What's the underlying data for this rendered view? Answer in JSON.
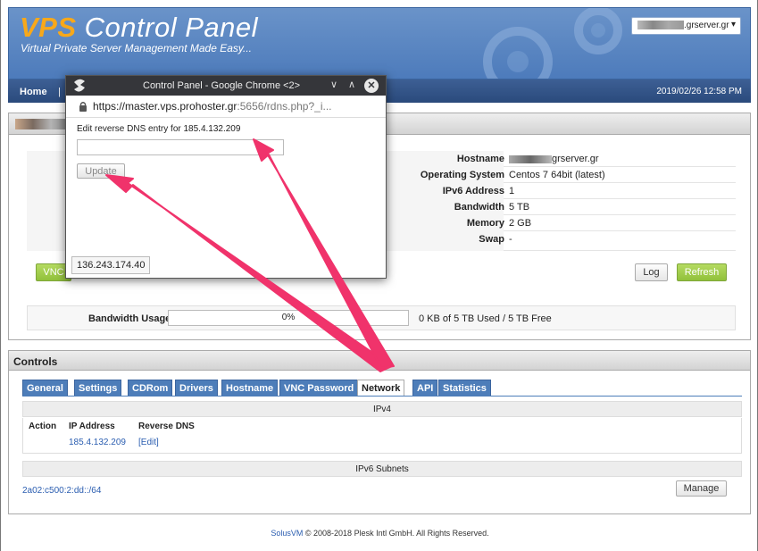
{
  "banner": {
    "brand_accent": "VPS",
    "brand_rest": " Control Panel",
    "tagline": "Virtual Private Server Management Made Easy...",
    "server_select_suffix": ".grserver.gr",
    "caret_icon": "▾"
  },
  "nav": {
    "home": "Home",
    "separator": "|",
    "datetime": "2019/02/26 12:58 PM"
  },
  "server_info": {
    "rows": [
      {
        "label": "Hostname",
        "value": "grserver.gr"
      },
      {
        "label": "Operating System",
        "value": "Centos 7 64bit (latest)"
      },
      {
        "label": "IPv6 Address",
        "value": "1"
      },
      {
        "label": "Bandwidth",
        "value": "5 TB"
      },
      {
        "label": "Memory",
        "value": "2 GB"
      },
      {
        "label": "Swap",
        "value": "-"
      }
    ],
    "vnc_label": "VNC",
    "log_label": "Log",
    "refresh_label": "Refresh",
    "bandwidth_usage_label": "Bandwidth Usage",
    "bandwidth_percent_text": "0%",
    "bandwidth_percent": 0,
    "bandwidth_text": "0 KB of 5 TB Used / 5 TB Free"
  },
  "controls": {
    "title": "Controls",
    "tabs": [
      "General",
      "Settings",
      "CDRom",
      "Drivers",
      "Hostname",
      "VNC Password",
      "Network",
      "API",
      "Statistics"
    ],
    "active_tab": "Network",
    "ipv4_header": "IPv4",
    "columns": [
      "Action",
      "IP Address",
      "Reverse DNS"
    ],
    "ipv4_rows": [
      {
        "action": "",
        "ip": "185.4.132.209",
        "rdns": "[Edit]"
      }
    ],
    "ipv6_header": "IPv6 Subnets",
    "ipv6_subnet": "2a02:c500:2:dd::/64",
    "manage_label": "Manage"
  },
  "footer": {
    "link": "SolusVM",
    "text": " © 2008-2018 Plesk Intl GmbH. All Rights Reserved."
  },
  "popup": {
    "title": "Control Panel - Google Chrome <2>",
    "min_icon": "∨",
    "max_icon": "∧",
    "close_icon": "✕",
    "url_host": "https://master.vps.prohoster.gr",
    "url_rest": ":5656/rdns.php?_i...",
    "rdns_label": "Edit reverse DNS entry for 185.4.132.209",
    "rdns_value": "",
    "update_label": "Update",
    "status_ip": "136.243.174.40"
  },
  "colors": {
    "banner": "#4d7bbb",
    "accent_orange": "#f8a81a",
    "tab_blue": "#4d7db9",
    "green_button": "#91c13b",
    "annotation_arrow": "#f0336b"
  }
}
